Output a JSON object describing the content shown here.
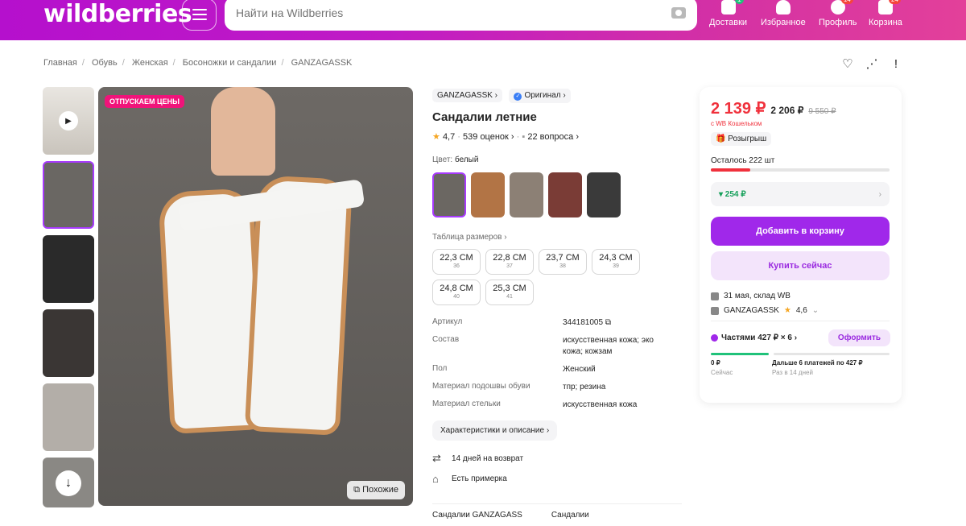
{
  "header": {
    "logo": "wildberries",
    "search_placeholder": "Найти на Wildberries",
    "nav": [
      {
        "label": "Доставки",
        "badge": "1"
      },
      {
        "label": "Избранное",
        "badge": ""
      },
      {
        "label": "Профиль",
        "badge": "14"
      },
      {
        "label": "Корзина",
        "badge": "24"
      }
    ]
  },
  "breadcrumbs": [
    "Главная",
    "Обувь",
    "Женская",
    "Босоножки и сандалии",
    "GANZAGASSK"
  ],
  "photo": {
    "promo": "ОТПУСКАЕМ ЦЕНЫ",
    "similar": "Похожие"
  },
  "product": {
    "brand": "GANZAGASSK",
    "original": "Оригинал",
    "title": "Сандалии летние",
    "rating": "4,7",
    "reviews": "539 оценок",
    "questions": "22 вопроса",
    "color_label": "Цвет:",
    "color_value": "белый",
    "size_table": "Таблица размеров",
    "sizes": [
      {
        "cm": "22,3 СМ",
        "ru": "36"
      },
      {
        "cm": "22,8 СМ",
        "ru": "37"
      },
      {
        "cm": "23,7 СМ",
        "ru": "38"
      },
      {
        "cm": "24,3 СМ",
        "ru": "39"
      },
      {
        "cm": "24,8 СМ",
        "ru": "40"
      },
      {
        "cm": "25,3 СМ",
        "ru": "41"
      }
    ],
    "specs": [
      {
        "k": "Артикул",
        "v": "344181005"
      },
      {
        "k": "Состав",
        "v": "искусственная кожа; эко кожа; кожзам"
      },
      {
        "k": "Пол",
        "v": "Женский"
      },
      {
        "k": "Материал подошвы обуви",
        "v": "тпр; резина"
      },
      {
        "k": "Материал стельки",
        "v": "искусственная кожа"
      }
    ],
    "desc_button": "Характеристики и описание",
    "return": "14 дней на возврат",
    "fitting": "Есть примерка",
    "bottom_tabs": [
      "Сандалии GANZAGASS",
      "Сандалии"
    ]
  },
  "buy": {
    "price": "2 139 ₽",
    "price_regular": "2 206 ₽",
    "price_old": "9 550 ₽",
    "wallet_note": "с WB Кошельком",
    "raffle": "Розыгрыш",
    "stock": "Осталось 222 шт",
    "stock_fraction": 0.22,
    "cashback": "▾ 254 ₽",
    "add_to_cart": "Добавить в корзину",
    "buy_now": "Купить сейчас",
    "delivery": "31 мая, склад WB",
    "seller": "GANZAGASSK",
    "seller_rating": "4,6",
    "parts": "Частями 427 ₽ × 6",
    "checkout": "Оформить",
    "pay_now": "0 ₽",
    "pay_now_label": "Сейчас",
    "pay_later": "Дальше 6 платежей по 427 ₽",
    "pay_later_label": "Раз в 14 дней"
  },
  "colors": {
    "accent": "#a028ea",
    "price": "#f0313c",
    "header_start": "#b510cd",
    "header_end": "#e3409a"
  }
}
